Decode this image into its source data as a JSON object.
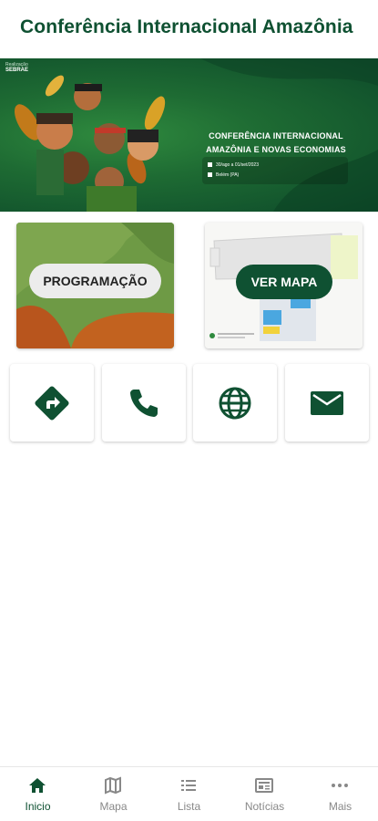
{
  "header": {
    "title": "Conferência Internacional Amazônia"
  },
  "banner": {
    "logo_line1": "Realização",
    "logo_brand": "SEBRAE",
    "heading_line1": "CONFERÊNCIA INTERNACIONAL",
    "heading_line2": "AMAZÔNIA E NOVAS ECONOMIAS",
    "date": "30/ago a 01/set/2023",
    "location": "Belém (PA)"
  },
  "cards": {
    "program_label": "PROGRAMAÇÃO",
    "map_label": "VER MAPA"
  },
  "actions": [
    {
      "icon": "directions-icon"
    },
    {
      "icon": "phone-icon"
    },
    {
      "icon": "globe-icon"
    },
    {
      "icon": "mail-icon"
    }
  ],
  "bottom_nav": [
    {
      "label": "Inicio",
      "icon": "home-icon",
      "active": true
    },
    {
      "label": "Mapa",
      "icon": "map-icon"
    },
    {
      "label": "Lista",
      "icon": "list-icon"
    },
    {
      "label": "Notícias",
      "icon": "news-icon"
    },
    {
      "label": "Mais",
      "icon": "more-icon"
    }
  ],
  "colors": {
    "brand": "#0f5132",
    "inactive": "#888888"
  }
}
